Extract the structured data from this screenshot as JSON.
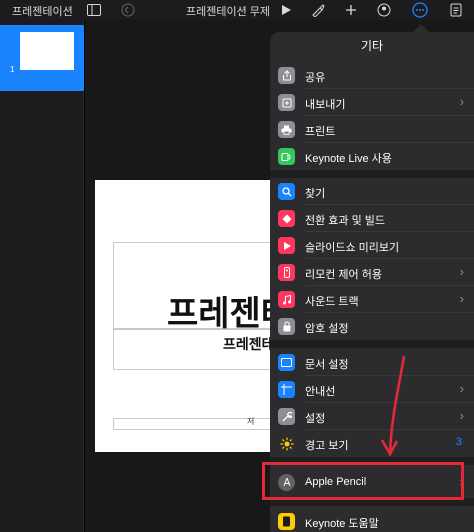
{
  "topbar": {
    "doc_name": "프레젠테이션",
    "title": "프레젠테이션 무제"
  },
  "sidebar": {
    "slides": [
      {
        "number": "1"
      }
    ]
  },
  "slide": {
    "title": "프레젠테",
    "subtitle": "프레젠테",
    "footer": "저"
  },
  "popover": {
    "title": "기타",
    "groups": [
      [
        {
          "label": "공유",
          "icon": "share-icon",
          "color": "#8e8e93",
          "chevron": false
        },
        {
          "label": "내보내기",
          "icon": "export-icon",
          "color": "#8e8e93",
          "chevron": true
        },
        {
          "label": "프린트",
          "icon": "print-icon",
          "color": "#8e8e93",
          "chevron": false
        },
        {
          "label": "Keynote Live 사용",
          "icon": "keynote-live-icon",
          "color": "#34c759",
          "chevron": false
        }
      ],
      [
        {
          "label": "찾기",
          "icon": "find-icon",
          "color": "#1a84ff",
          "chevron": false
        },
        {
          "label": "전환 효과 및 빌드",
          "icon": "transition-icon",
          "color": "#ff375f",
          "chevron": false
        },
        {
          "label": "슬라이드쇼 미리보기",
          "icon": "slideshow-icon",
          "color": "#ff375f",
          "chevron": false
        },
        {
          "label": "리모컨 제어 허용",
          "icon": "remote-icon",
          "color": "#ff375f",
          "chevron": true
        },
        {
          "label": "사운드 트랙",
          "icon": "music-icon",
          "color": "#ff375f",
          "chevron": true
        },
        {
          "label": "암호 설정",
          "icon": "lock-icon",
          "color": "#8e8e93",
          "chevron": false
        }
      ],
      [
        {
          "label": "문서 설정",
          "icon": "document-setup-icon",
          "color": "#1a84ff",
          "chevron": false
        },
        {
          "label": "안내선",
          "icon": "guides-icon",
          "color": "#1a84ff",
          "chevron": true
        },
        {
          "label": "설정",
          "icon": "wrench-icon",
          "color": "#8e8e93",
          "chevron": true
        },
        {
          "label": "경고 보기",
          "icon": "warning-icon",
          "color": "#ffcc00",
          "chevron": false,
          "badge": "3"
        }
      ],
      [
        {
          "label": "Apple Pencil",
          "icon": "apple-pencil-icon",
          "color": "#8e8e93",
          "chevron": true
        }
      ],
      [
        {
          "label": "Keynote 도움말",
          "icon": "help-book-icon",
          "color": "#ffcc00",
          "chevron": false
        }
      ]
    ]
  }
}
